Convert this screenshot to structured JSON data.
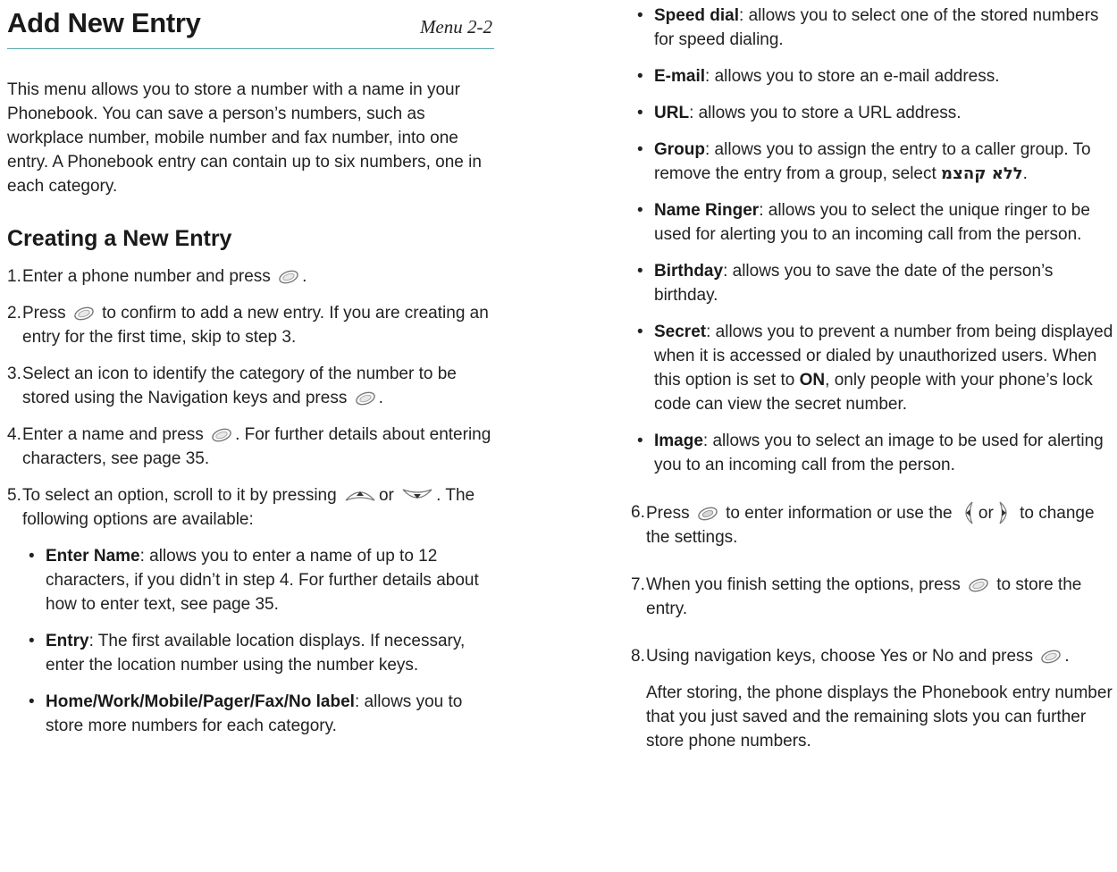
{
  "header": {
    "title": "Add New Entry",
    "menu_ref": "Menu 2-2"
  },
  "intro": "This menu allows you to store a number with a name in your Phonebook. You can save a person’s numbers, such as workplace number, mobile number and fax number, into one entry. A Phonebook entry can contain up to six numbers, one in each category.",
  "section_heading": "Creating a New Entry",
  "steps": {
    "s1": {
      "num": "1.",
      "a": "Enter a phone number and press",
      "b": "."
    },
    "s2": {
      "num": "2.",
      "a": "Press",
      "b": "to confirm to add a new entry. If you are creating an entry for the first time, skip to step 3."
    },
    "s3": {
      "num": "3.",
      "a": "Select an icon to identify the category of the number to be stored using the Navigation keys and press",
      "b": "."
    },
    "s4": {
      "num": "4.",
      "a": "Enter a name and press",
      "b": ". For further details about entering characters, see page 35."
    },
    "s5": {
      "num": "5.",
      "a": "To select an option, scroll to it by pressing",
      "or": "or",
      "b": ". The following options are available:"
    },
    "s6": {
      "num": "6.",
      "a": "Press",
      "b": "to enter information or use the",
      "or": "or",
      "c": "to change the settings."
    },
    "s7": {
      "num": "7.",
      "a": "When you finish setting the options, press",
      "b": "to store the entry."
    },
    "s8": {
      "num": "8.",
      "a": "Using navigation keys, choose Yes or No and press",
      "b": "."
    },
    "after": "After storing, the phone displays the Phonebook entry number that you just saved and the remaining slots you can further store phone numbers."
  },
  "options": {
    "enter_name": {
      "term": "Enter Name",
      "text": ": allows you to enter a name of up to 12 characters, if you didn’t in step 4. For further details about how to enter text, see page 35."
    },
    "entry": {
      "term": "Entry",
      "text": ": The first available location displays. If necessary, enter the location number using the number keys."
    },
    "labels": {
      "term": "Home/Work/Mobile/Pager/Fax/No label",
      "text": ": allows you to store more numbers for each category."
    },
    "speed_dial": {
      "term": "Speed dial",
      "text": ": allows you to select one of the stored numbers for speed dialing."
    },
    "email": {
      "term": "E-mail",
      "text": ": allows you to store an e-mail address."
    },
    "url": {
      "term": "URL",
      "text": ": allows you to store a URL address."
    },
    "group": {
      "term": "Group",
      "text": ": allows you to assign the entry to a caller group. To remove the entry from a group, select",
      "value": "ללא קהצמ",
      "end": "."
    },
    "name_ringer": {
      "term": "Name Ringer",
      "text": ": allows you to select the unique ringer to be used for alerting you to an incoming call from the person."
    },
    "birthday": {
      "term": "Birthday",
      "text": ": allows you to save the date of the person’s birthday."
    },
    "secret": {
      "term": "Secret",
      "text_a": ": allows you to prevent a number from being displayed when it is accessed or dialed by unauthorized users. When this option is set to",
      "on": "ON",
      "text_b": ", only people with your phone’s lock code can view the secret number."
    },
    "image": {
      "term": "Image",
      "text": ": allows you to select an image to be used for alerting you to an incoming call from the person."
    }
  },
  "icons": {
    "ok_key": "ok-key-icon",
    "menu_key": "menu-key-icon",
    "up_key": "up-key-icon",
    "down_key": "down-key-icon",
    "left_key": "left-key-icon",
    "right_key": "right-key-icon"
  },
  "colors": {
    "rule": "#5aa9b3",
    "text": "#222222"
  }
}
